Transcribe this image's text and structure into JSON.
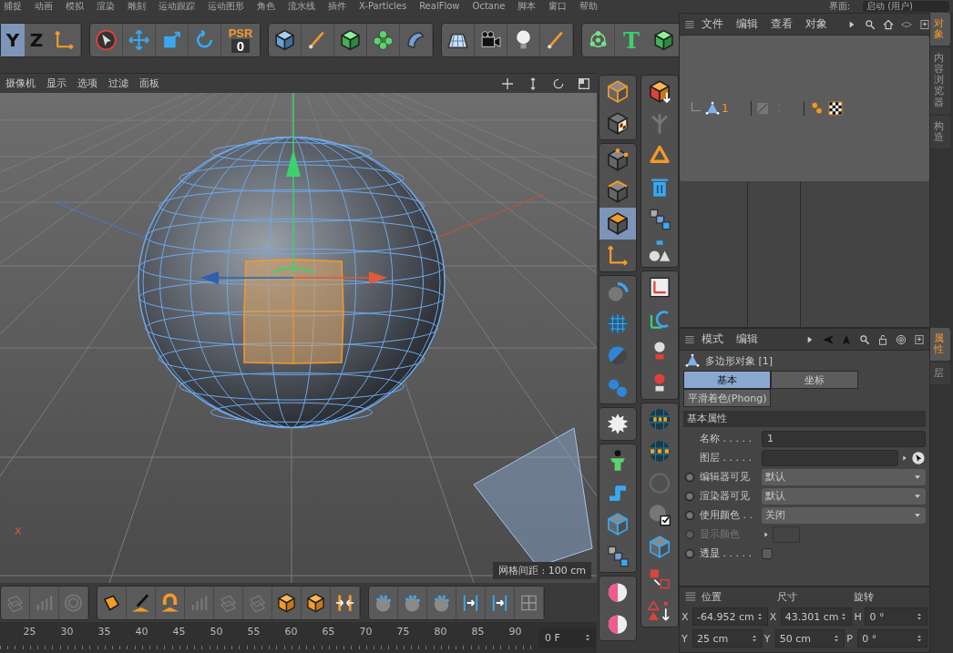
{
  "menu_bar": {
    "items": [
      "捕捉",
      "动画",
      "模拟",
      "渲染",
      "雕刻",
      "运动跟踪",
      "运动图形",
      "角色",
      "流水线",
      "插件",
      "X-Particles",
      "RealFlow",
      "Octane",
      "脚本",
      "窗口",
      "帮助"
    ],
    "layout_label": "界面:",
    "layout_value": "启动 (用户)"
  },
  "toolbar": {
    "axis_buttons": [
      "Y",
      "Z"
    ],
    "psr": {
      "label": "PSR",
      "value": "0"
    },
    "text_tool": "T"
  },
  "viewport": {
    "menu": [
      "摄像机",
      "显示",
      "选项",
      "过滤",
      "面板"
    ],
    "axis_label": "X",
    "grid_spacing": "网格间距 : 100 cm"
  },
  "modes": [
    {
      "selected": false
    },
    {
      "selected": false
    },
    {
      "selected": true
    },
    {
      "selected": false
    }
  ],
  "timeline": {
    "ticks": [
      "25",
      "30",
      "35",
      "40",
      "45",
      "50",
      "55",
      "60",
      "65",
      "70",
      "75",
      "80",
      "85",
      "90"
    ],
    "frame": "0 F"
  },
  "object_manager": {
    "menu": [
      "文件",
      "编辑",
      "查看",
      "对象"
    ],
    "objects": [
      {
        "name": "1",
        "selected": true
      }
    ]
  },
  "side_tabs_top": [
    {
      "label": "对象",
      "selected": true
    },
    {
      "label": "内容浏览器",
      "selected": false
    },
    {
      "label": "构造",
      "selected": false
    }
  ],
  "attributes": {
    "menu": [
      "模式",
      "编辑"
    ],
    "title": "多边形对象 [1]",
    "tabs": [
      {
        "label": "基本",
        "selected": true
      },
      {
        "label": "坐标",
        "selected": false
      },
      {
        "label": "平滑着色(Phong)",
        "selected": false
      }
    ],
    "section": "基本属性",
    "fields": [
      {
        "label": "名称 . . . . .",
        "kind": "text",
        "value": "1",
        "disabled": false
      },
      {
        "label": "图层 . . . . .",
        "kind": "link",
        "disabled": false
      },
      {
        "label": "编辑器可见",
        "kind": "select",
        "value": "默认",
        "disabled": false
      },
      {
        "label": "渲染器可见",
        "kind": "select",
        "value": "默认",
        "disabled": false
      },
      {
        "label": "使用颜色 . .",
        "kind": "select",
        "value": "关闭",
        "disabled": false
      },
      {
        "label": "显示颜色",
        "kind": "color",
        "disabled": true
      },
      {
        "label": "透显 . . . . .",
        "kind": "checkbox",
        "checked": false,
        "disabled": false
      }
    ]
  },
  "side_tabs_bottom": [
    {
      "label": "属性",
      "selected": true
    },
    {
      "label": "层",
      "selected": false
    }
  ],
  "coordinates": {
    "headers": [
      "位置",
      "尺寸",
      "旋转"
    ],
    "rows": [
      {
        "cells": [
          {
            "axis": "X",
            "value": "-64.952 cm"
          },
          {
            "axis": "X",
            "value": "43.301 cm"
          },
          {
            "axis": "H",
            "value": "0 °"
          }
        ]
      },
      {
        "cells": [
          {
            "axis": "Y",
            "value": "25 cm"
          },
          {
            "axis": "Y",
            "value": "50 cm"
          },
          {
            "axis": "P",
            "value": "0 °"
          }
        ]
      }
    ]
  }
}
